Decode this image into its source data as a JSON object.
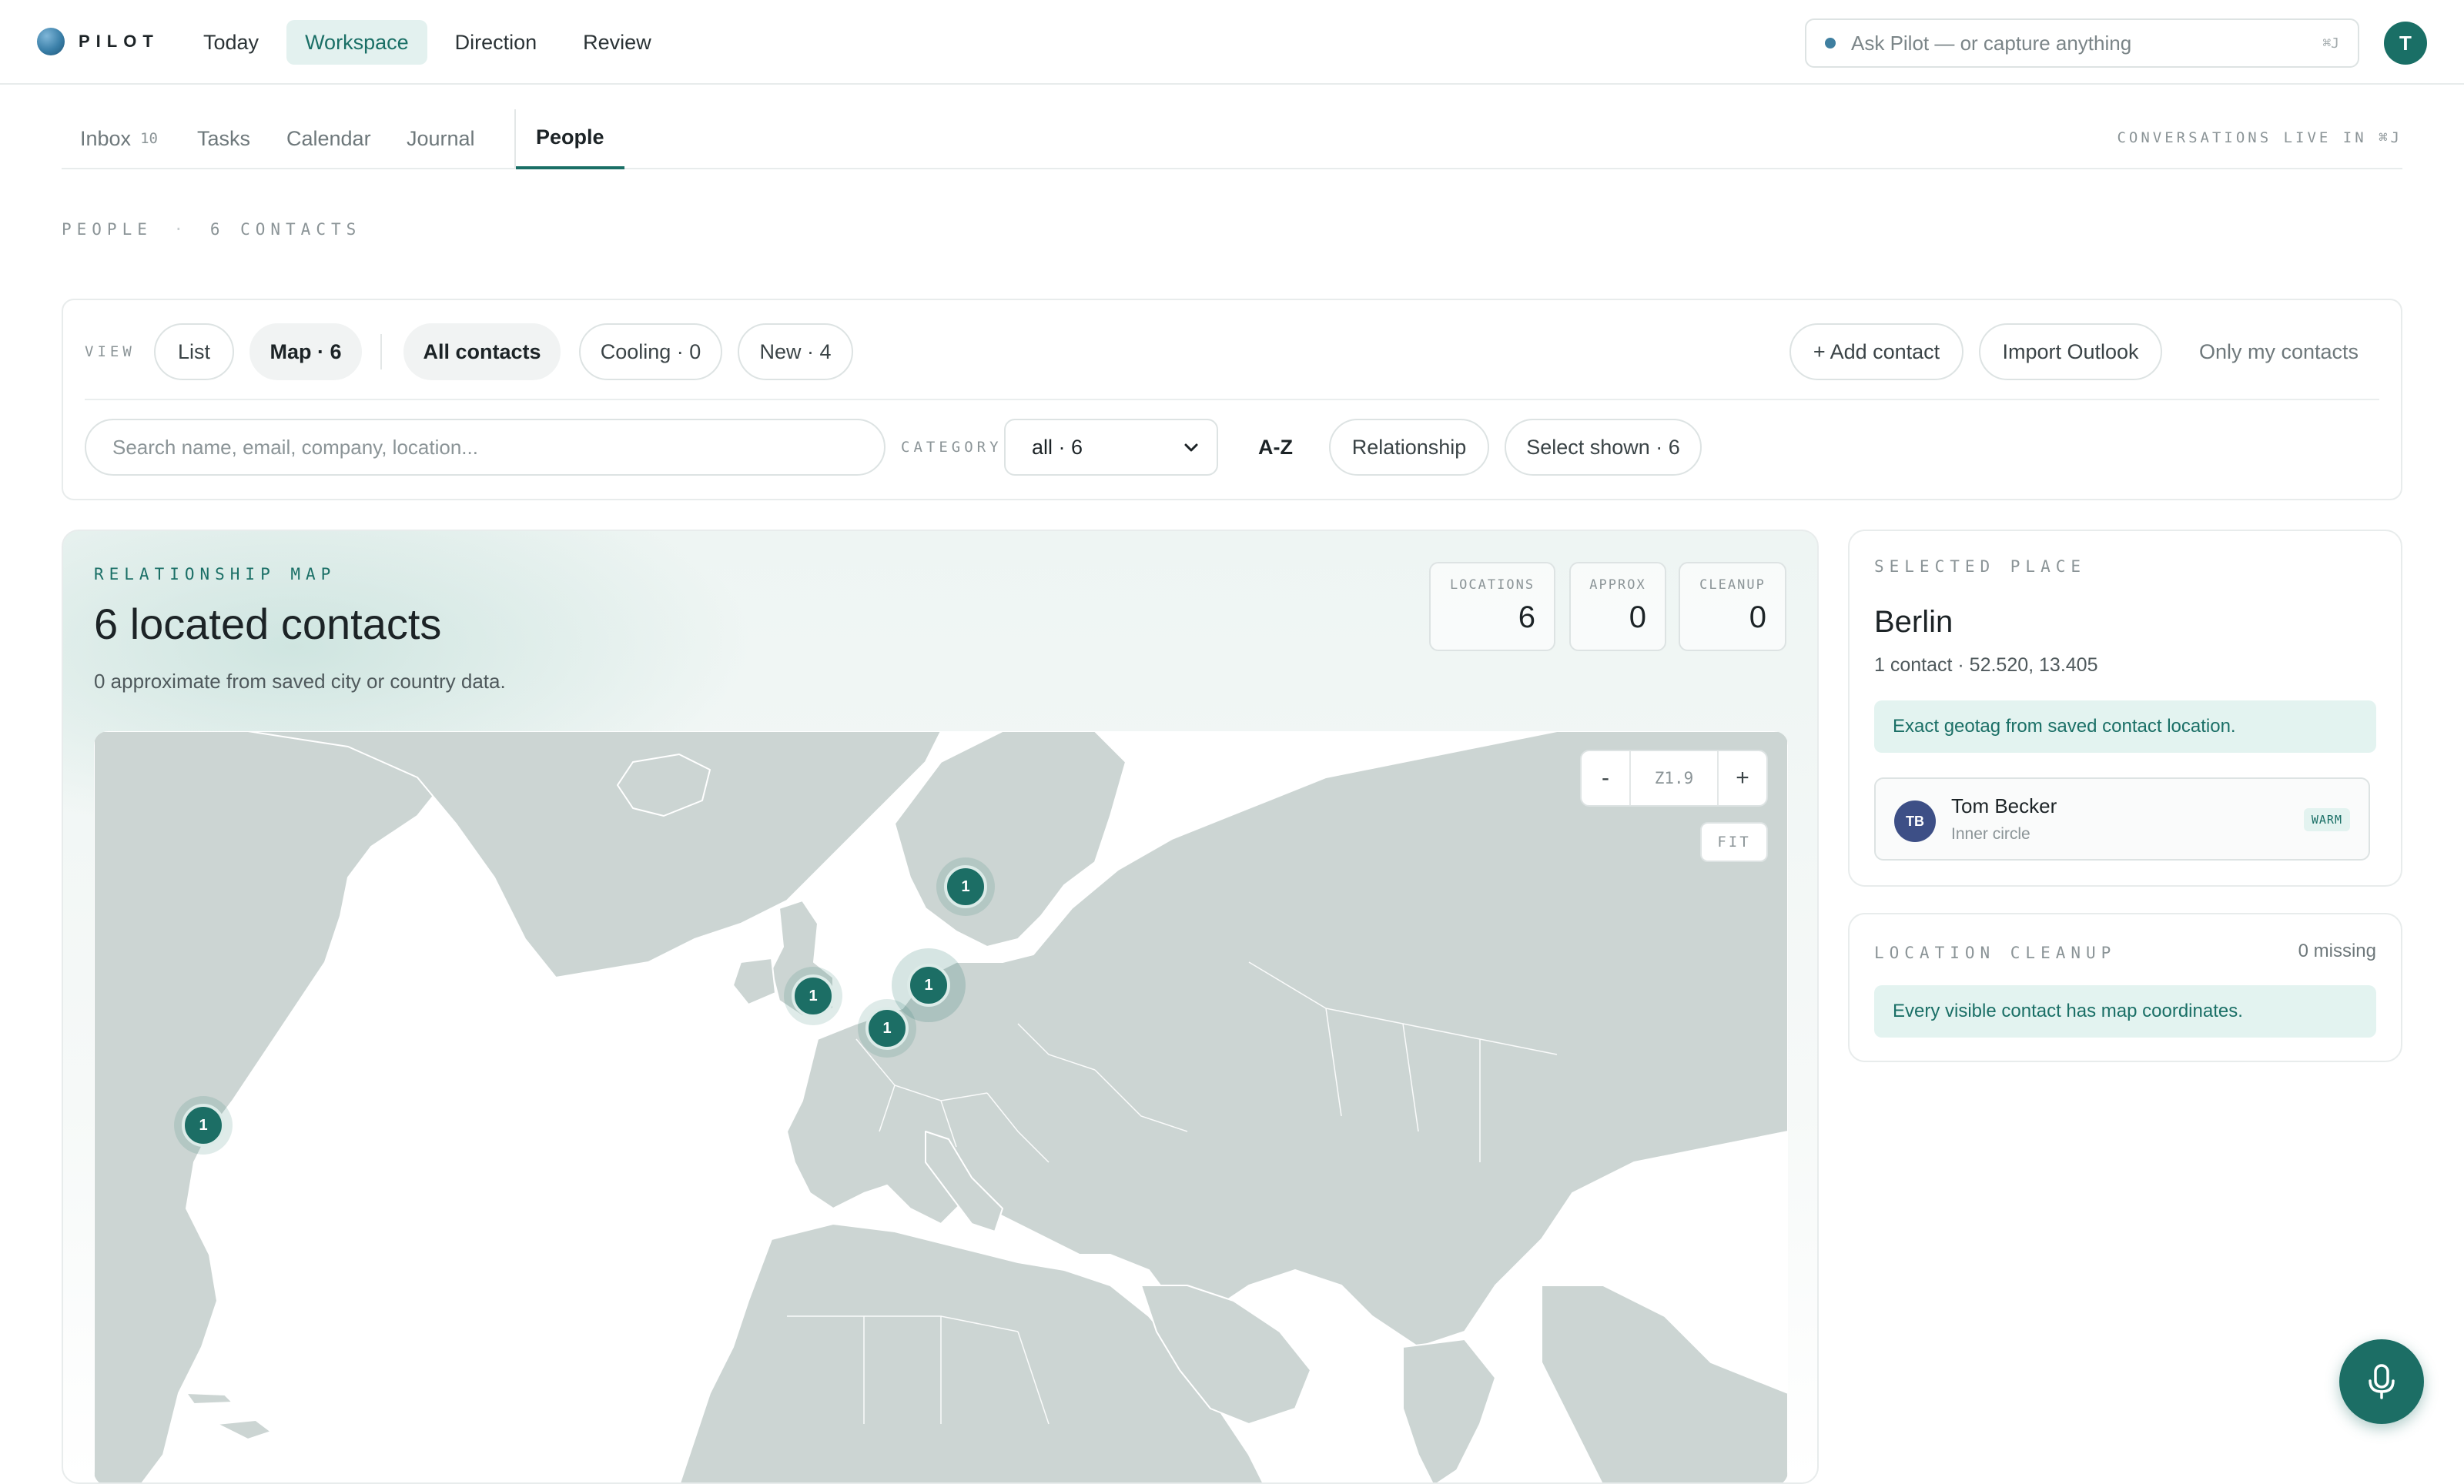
{
  "app": {
    "logo_text": "PILOT",
    "nav": [
      "Today",
      "Workspace",
      "Direction",
      "Review"
    ],
    "active_nav": "Workspace",
    "ask_placeholder": "Ask Pilot — or capture anything",
    "ask_shortcut": "⌘J",
    "user_initial": "T"
  },
  "subtabs": {
    "items": [
      {
        "label": "Inbox",
        "count": "10"
      },
      {
        "label": "Tasks"
      },
      {
        "label": "Calendar"
      },
      {
        "label": "Journal"
      },
      {
        "label": "People"
      }
    ],
    "active": "People",
    "note": "CONVERSATIONS LIVE IN ⌘J"
  },
  "breadcrumb": {
    "section": "PEOPLE",
    "sep": "·",
    "count": "6 CONTACTS"
  },
  "filters": {
    "view_label": "VIEW",
    "view_list": "List",
    "view_map": "Map · 6",
    "all_contacts": "All contacts",
    "cooling": "Cooling · 0",
    "new": "New · 4",
    "add_contact": "+ Add contact",
    "import_outlook": "Import Outlook",
    "only_mine": "Only my contacts",
    "search_placeholder": "Search name, email, company, location...",
    "category_label": "CATEGORY",
    "category_value": "all · 6",
    "sort": "A-Z",
    "relationship": "Relationship",
    "select_shown": "Select shown · 6"
  },
  "map": {
    "label": "RELATIONSHIP MAP",
    "title": "6 located contacts",
    "subtitle": "0 approximate from saved city or country data.",
    "stats": [
      {
        "key": "LOCATIONS",
        "value": "6"
      },
      {
        "key": "APPROX",
        "value": "0"
      },
      {
        "key": "CLEANUP",
        "value": "0"
      }
    ],
    "zoom_out": "-",
    "zoom_in": "+",
    "zoom_level": "Z1.9",
    "fit": "FIT",
    "markers": [
      {
        "count": "1",
        "place": "Stockholm",
        "lat": 59.33,
        "lon": 18.07
      },
      {
        "count": "1",
        "place": "Berlin",
        "lat": 52.52,
        "lon": 13.405,
        "selected": true
      },
      {
        "count": "1",
        "place": "London",
        "lat": 51.5,
        "lon": -0.12
      },
      {
        "count": "1",
        "place": "Zurich",
        "lat": 47.37,
        "lon": 8.54
      },
      {
        "count": "1",
        "place": "New York",
        "lat": 40.71,
        "lon": -74.0
      }
    ]
  },
  "selected_place": {
    "label": "SELECTED PLACE",
    "name": "Berlin",
    "meta": "1 contact · 52.520, 13.405",
    "note": "Exact geotag from saved contact location.",
    "contact": {
      "initials": "TB",
      "name": "Tom Becker",
      "relationship": "Inner circle",
      "tag": "WARM"
    }
  },
  "cleanup": {
    "label": "LOCATION CLEANUP",
    "missing": "0 missing",
    "note": "Every visible contact has map coordinates."
  },
  "colors": {
    "accent": "#1a6f66",
    "land": "#ccd5d3",
    "sea": "#ffffff"
  }
}
